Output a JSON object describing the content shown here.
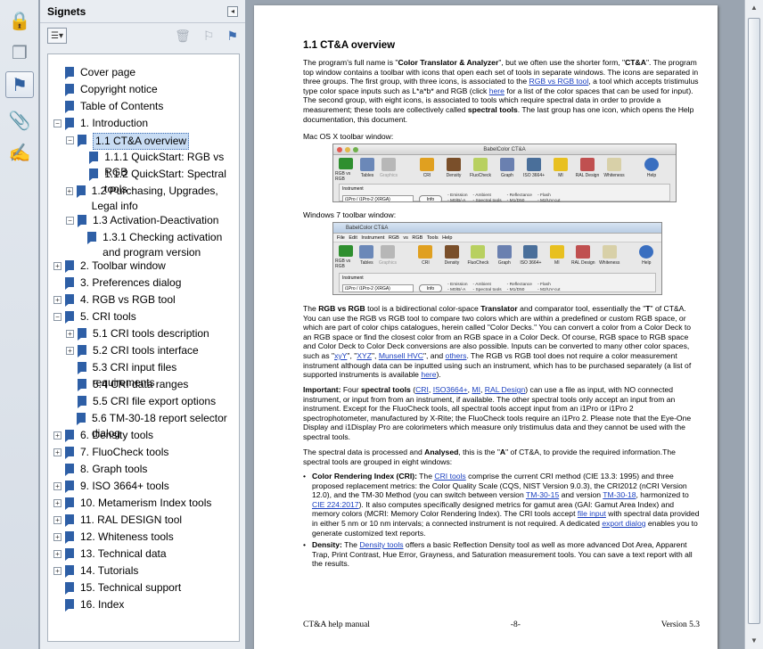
{
  "panel": {
    "title": "Signets",
    "collapse_glyph": "◂",
    "options_glyph": "☰▾"
  },
  "tree": [
    {
      "label": "Cover page",
      "level": 0,
      "exp": ""
    },
    {
      "label": "Copyright notice",
      "level": 0,
      "exp": ""
    },
    {
      "label": "Table of Contents",
      "level": 0,
      "exp": ""
    },
    {
      "label": "1. Introduction",
      "level": 0,
      "exp": "−"
    },
    {
      "label": "1.1 CT&A overview",
      "level": 1,
      "exp": "−",
      "selected": true
    },
    {
      "label": "1.1.1 QuickStart: RGB vs RGB",
      "level": 2,
      "exp": ""
    },
    {
      "label": "1.1.2 QuickStart: Spectral tools",
      "level": 2,
      "exp": ""
    },
    {
      "label": "1.2 Purchasing, Upgrades, Legal info",
      "level": 1,
      "exp": "+"
    },
    {
      "label": "1.3 Activation-Deactivation",
      "level": 1,
      "exp": "−"
    },
    {
      "label": "1.3.1 Checking activation and program version",
      "level": 2,
      "exp": ""
    },
    {
      "label": "2. Toolbar window",
      "level": 0,
      "exp": "+"
    },
    {
      "label": "3. Preferences dialog",
      "level": 0,
      "exp": ""
    },
    {
      "label": "4. RGB vs RGB tool",
      "level": 0,
      "exp": "+"
    },
    {
      "label": "5. CRI tools",
      "level": 0,
      "exp": "−"
    },
    {
      "label": "5.1 CRI tools description",
      "level": 1,
      "exp": "+"
    },
    {
      "label": "5.2 CRI tools interface",
      "level": 1,
      "exp": "+"
    },
    {
      "label": "5.3 CRI input files requirements",
      "level": 1,
      "exp": ""
    },
    {
      "label": "5.4 CRI data ranges",
      "level": 1,
      "exp": ""
    },
    {
      "label": "5.5 CRI file export options",
      "level": 1,
      "exp": ""
    },
    {
      "label": "5.6 TM-30-18 report selector dialog",
      "level": 1,
      "exp": ""
    },
    {
      "label": "6. Density tools",
      "level": 0,
      "exp": "+"
    },
    {
      "label": "7. FluoCheck tools",
      "level": 0,
      "exp": "+"
    },
    {
      "label": "8. Graph tools",
      "level": 0,
      "exp": ""
    },
    {
      "label": "9. ISO 3664+ tools",
      "level": 0,
      "exp": "+"
    },
    {
      "label": "10. Metamerism Index tools",
      "level": 0,
      "exp": "+"
    },
    {
      "label": "11. RAL DESIGN tool",
      "level": 0,
      "exp": "+"
    },
    {
      "label": "12. Whiteness tools",
      "level": 0,
      "exp": "+"
    },
    {
      "label": "13. Technical data",
      "level": 0,
      "exp": "+"
    },
    {
      "label": "14. Tutorials",
      "level": 0,
      "exp": "+"
    },
    {
      "label": "15. Technical support",
      "level": 0,
      "exp": ""
    },
    {
      "label": "16. Index",
      "level": 0,
      "exp": ""
    }
  ],
  "doc": {
    "heading": "1.1   CT&A overview",
    "p1": [
      {
        "t": "The program's full name is \""
      },
      {
        "t": "Color Translator & Analyzer",
        "b": true
      },
      {
        "t": "\", but we often use the shorter form, \""
      },
      {
        "t": "CT&A",
        "b": true
      },
      {
        "t": "\". The program top window contains a toolbar with icons that open each set of tools in separate windows. The icons are separated in three groups. The first group, with three icons, is associated to the "
      },
      {
        "t": "RGB vs RGB tool",
        "l": true
      },
      {
        "t": ", a tool which accepts tristimulus type color space inputs such as L*a*b* and RGB (click "
      },
      {
        "t": "here",
        "l": true
      },
      {
        "t": " for a list of the color spaces that can be used for input). The second group, with eight icons, is associated to tools which require spectral data in order to provide a measurement; these tools are collectively called "
      },
      {
        "t": "spectral tools",
        "b": true
      },
      {
        "t": ". The last group has one icon, which opens the Help documentation, this document."
      }
    ],
    "mac_caption": "Mac OS X toolbar window:",
    "win_caption": "Windows 7 toolbar window:",
    "p2": [
      {
        "t": "The "
      },
      {
        "t": "RGB vs RGB",
        "b": true
      },
      {
        "t": " tool is a bidirectional color-space "
      },
      {
        "t": "Translator",
        "b": true
      },
      {
        "t": " and comparator tool, essentially the \""
      },
      {
        "t": "T",
        "b": true
      },
      {
        "t": "\" of CT&A. You can use the RGB vs RGB tool to compare two colors which are within a predefined or custom RGB space, or which are part of color chips catalogues, herein called \"Color Decks.\" You can convert a color from a Color Deck to an RGB space or find the closest color from an RGB space in a Color Deck. Of course, RGB space to RGB space and Color Deck to Color Deck conversions are also possible. Inputs can be converted to many other color spaces, such as \""
      },
      {
        "t": "xyY",
        "l": true
      },
      {
        "t": "\", \""
      },
      {
        "t": "XYZ",
        "l": true
      },
      {
        "t": "\", "
      },
      {
        "t": "Munsell HVC",
        "l": true
      },
      {
        "t": "\", and "
      },
      {
        "t": "others",
        "l": true
      },
      {
        "t": ". The RGB vs RGB tool does not require a color measurement instrument although data can be inputted using such an instrument, which has to be purchased separately (a list of supported instruments is available "
      },
      {
        "t": "here",
        "l": true
      },
      {
        "t": ")."
      }
    ],
    "p3": [
      {
        "t": "Important:",
        "b": true
      },
      {
        "t": " Four "
      },
      {
        "t": "spectral tools",
        "b": true
      },
      {
        "t": " ("
      },
      {
        "t": "CRI",
        "l": true
      },
      {
        "t": ", "
      },
      {
        "t": "ISO3664+",
        "l": true
      },
      {
        "t": ", "
      },
      {
        "t": "MI",
        "l": true
      },
      {
        "t": ", "
      },
      {
        "t": "RAL Design",
        "l": true
      },
      {
        "t": ") can use a file as input, with NO connected instrument, or input from from an instrument, if available. The other spectral tools only accept an input from an instrument. Except for the FluoCheck tools, all spectral tools accept input from an i1Pro or i1Pro 2 spectrophotometer, manufactured by X-Rite; the FluoCheck tools require an i1Pro 2. Please note that the Eye-One Display and i1Display Pro are colorimeters which measure only tristimulus data and they cannot be used with the spectral tools."
      }
    ],
    "p4": [
      {
        "t": "The spectral data is processed and "
      },
      {
        "t": "Analysed",
        "b": true
      },
      {
        "t": ", this is the \""
      },
      {
        "t": "A",
        "b": true
      },
      {
        "t": "\" of CT&A, to provide the required information.The spectral tools are grouped in eight windows:"
      }
    ],
    "bullet1": [
      {
        "t": "Color Rendering Index (CRI):",
        "b": true
      },
      {
        "t": " The "
      },
      {
        "t": "CRI tools",
        "l": true
      },
      {
        "t": " comprise the current CRI method (CIE 13.3: 1995) and three proposed replacement metrics: the Color Quality Scale (CQS, NIST Version 9.0.3), the CRI2012 (nCRI Version 12.0), and the TM-30 Method (you can switch between version "
      },
      {
        "t": "TM-30-15",
        "l": true
      },
      {
        "t": " and version "
      },
      {
        "t": "TM-30-18",
        "l": true
      },
      {
        "t": ", harmonized to "
      },
      {
        "t": "CIE 224:2017",
        "l": true
      },
      {
        "t": "). It also computes specifically designed metrics for gamut area (GAI: Gamut Area Index) and memory colors (MCRI: Memory Color Rendering Index). The CRI tools accept "
      },
      {
        "t": "file input",
        "l": true
      },
      {
        "t": " with spectral data provided in either 5 nm or 10 nm intervals; a connected instrument is not required. A dedicated "
      },
      {
        "t": "export dialog",
        "l": true
      },
      {
        "t": " enables you to generate customized text reports."
      }
    ],
    "bullet2": [
      {
        "t": "Density:",
        "b": true
      },
      {
        "t": " The "
      },
      {
        "t": "Density tools",
        "l": true
      },
      {
        "t": " offers a basic Reflection Density tool as well as more advanced Dot Area, Apparent Trap, Print Contrast, Hue Error, Grayness, and Saturation measurement tools. You can save a text report with all the results."
      }
    ],
    "footer": {
      "left": "CT&A help manual",
      "center": "-8-",
      "right": "Version 5.3"
    }
  },
  "mac_window": {
    "title": "BabelColor CT&A",
    "icons": [
      "RGB vs RGB",
      "Tables",
      "Graphics",
      "CRI",
      "Density",
      "FluoCheck",
      "Graph",
      "ISO 3664+",
      "MI",
      "RAL Design",
      "Whiteness",
      "Help"
    ],
    "instrument_label": "Instrument",
    "instrument_value": "i1Pro / i1Pro-2 (XRGA)",
    "info_button": "Info",
    "options": [
      "Emission",
      "Ambient",
      "Reflectance",
      "Flash",
      "M0/B/-A",
      "Spectral tools",
      "M1/D50",
      "M2/UV-cut"
    ]
  },
  "win_window": {
    "title": "BabelColor CT&A",
    "menu": "File  Edit  Instrument  RGB vs RGB  Tools  Help",
    "icons": [
      "RGB vs RGB",
      "Tables",
      "Graphics",
      "CRI",
      "Density",
      "FluoCheck",
      "Graph",
      "ISO 3664+",
      "MI",
      "RAL Design",
      "Whiteness",
      "Help"
    ],
    "instrument_label": "Instrument",
    "instrument_value": "i1Pro / i1Pro-2 (XRGA)",
    "info_button": "Info",
    "options": [
      "Emission",
      "Ambient",
      "Reflectance",
      "Flash",
      "M0/B/-A",
      "Spectral tools",
      "M1/D50",
      "M2/UV-cut"
    ]
  },
  "icon_colors": [
    "#2f8f2f",
    "#6b88b8",
    "#b7b7b7",
    "#e0a020",
    "#7a4f2a",
    "#b8d060",
    "#6a80b0",
    "#4a6f9a",
    "#e8c020",
    "#c05050",
    "#d8d0a8",
    "#3a6fc0"
  ]
}
